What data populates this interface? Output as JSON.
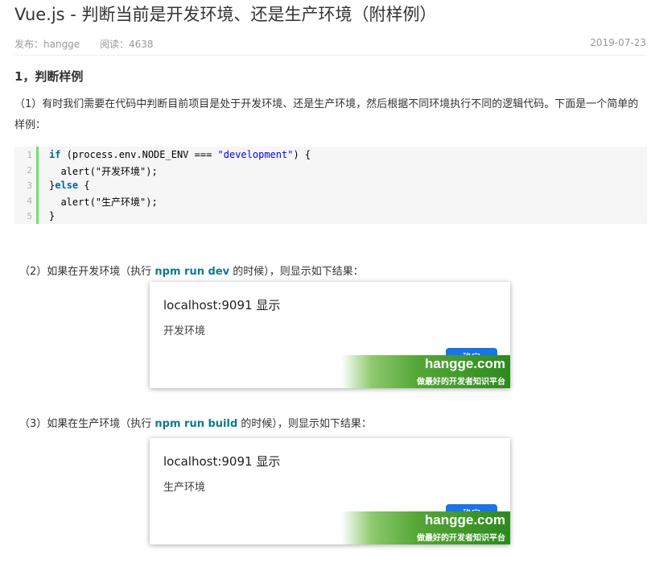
{
  "article": {
    "title": "Vue.js - 判断当前是开发环境、还是生产环境（附样例）",
    "publisher_label": "发布：hangge",
    "reads_label": "阅读：4638",
    "date": "2019-07-23"
  },
  "section1": {
    "heading": "1，判断样例",
    "paragraph": "（1）有时我们需要在代码中判断目前项目是处于开发环境、还是生产环境，然后根据不同环境执行不同的逻辑代码。下面是一个简单的样例："
  },
  "code": {
    "line_numbers": [
      "1",
      "2",
      "3",
      "4",
      "5"
    ],
    "l1_kw": "if",
    "l1_mid": " (process.env.NODE_ENV === ",
    "l1_str": "\"development\"",
    "l1_end": ") {",
    "l2": "  alert(\"开发环境\");",
    "l3_pre": "}",
    "l3_kw": "else",
    "l3_end": " {",
    "l4": "  alert(\"生产环境\");",
    "l5": "}"
  },
  "step2": {
    "pre": "（2）如果在开发环境（执行 ",
    "cmd": "npm run dev",
    "post": " 的时候），则显示如下结果："
  },
  "step3": {
    "pre": "（3）如果在生产环境（执行 ",
    "cmd": "npm run build",
    "post": " 的时候），则显示如下结果："
  },
  "dialog_dev": {
    "header": "localhost:9091 显示",
    "message": "开发环境",
    "ok_label": "确定"
  },
  "dialog_prod": {
    "header": "localhost:9091 显示",
    "message": "生产环境",
    "ok_label": "确定"
  },
  "watermark": {
    "site": "hangge.com",
    "slogan": "做最好的开发者知识平台"
  },
  "colors": {
    "code_gutter_border": "#6ce26c",
    "keyword": "#006699",
    "string": "#0000ff",
    "command": "#117a8b",
    "dialog_button": "#1a73e8",
    "watermark_green": "#2d8a1e"
  }
}
